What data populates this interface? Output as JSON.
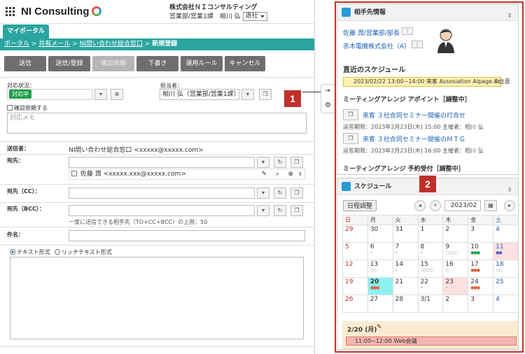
{
  "header": {
    "brand": "NI Consulting",
    "company": "株式会社ＮＩコンサルティング",
    "dept": "営業部/営業1課",
    "user": "相川 弘",
    "status_select": "退社"
  },
  "tab": "マイポータル",
  "breadcrumb": [
    "ポータル",
    "共有メール",
    "NI問い合わせ総合窓口",
    "新規登録"
  ],
  "toolbar": [
    "送信",
    "送信/登録",
    "確認依頼",
    "下書き",
    "運用ルール",
    "キャンセル"
  ],
  "form": {
    "status_label": "対応状況：",
    "status_value": "対応中",
    "assignee_label": "担当者：",
    "assignee_value": "相川 弘（営業部/営業1課）",
    "confirm_label": "確認依頼する",
    "memo_placeholder": "対応メモ",
    "sender_label": "送信者：",
    "sender_value": "NI問い合わせ総合窓口 <xxxxx@xxxxx.com>",
    "to_label": "宛先：",
    "to_entry": "佐藤 潤 <xxxxx.xxx@xxxxx.com>",
    "cc_label": "宛先（CC）：",
    "bcc_label": "宛先（BCC）：",
    "limit_note": "一度に送信できる相手先（TO+CC+BCC）の上限：50",
    "subject_label": "件名：",
    "format_text": "テキスト形式",
    "format_rich": "リッチテキスト形式"
  },
  "markers": [
    "1",
    "2"
  ],
  "contact_panel": {
    "title": "相手先情報",
    "person": "佐藤 潤/営業部/部長",
    "company": "赤木電機株式会社（A）",
    "recent_title": "直近のスケジュール",
    "recent_item": "2023/02/22 13:00~14:00 来客 Assosiation Alpage.Co",
    "recent_note": "※注意",
    "arrange_title": "ミーティングアレンジ アポイント［調整中］",
    "arrange_items": [
      {
        "title": "来客 ３社合同セミナー開催の打合せ",
        "meta": "返答期限：2023年2月23日(木) 15:00 主催者：相川 弘"
      },
      {
        "title": "来客 ３社合同セミナー開催のＭＴＧ",
        "meta": "返答期限：2023年2月23日(木) 16:00 主催者：相川 弘"
      }
    ],
    "reserve_title": "ミーティングアレンジ 予約受付［調整中］"
  },
  "schedule_panel": {
    "title": "スケジュール",
    "adjust_button": "日程調整",
    "month": "2023/02",
    "weekdays": [
      "日",
      "月",
      "火",
      "水",
      "木",
      "金",
      "土"
    ],
    "weeks": [
      [
        "29",
        "30",
        "31",
        "1",
        "2",
        "3",
        "4"
      ],
      [
        "5",
        "6",
        "7",
        "8",
        "9",
        "10",
        "11"
      ],
      [
        "12",
        "13",
        "14",
        "15",
        "16",
        "17",
        "18"
      ],
      [
        "19",
        "20",
        "21",
        "22",
        "23",
        "24",
        "25"
      ],
      [
        "26",
        "27",
        "28",
        "3/1",
        "2",
        "3",
        "4"
      ]
    ],
    "day_title": "2/20 (月)",
    "day_item": "11:00~12:00 Web会議"
  },
  "colors": {
    "teal": "#2aa5a0",
    "red": "#c0302a",
    "green": "#1fa14a"
  }
}
